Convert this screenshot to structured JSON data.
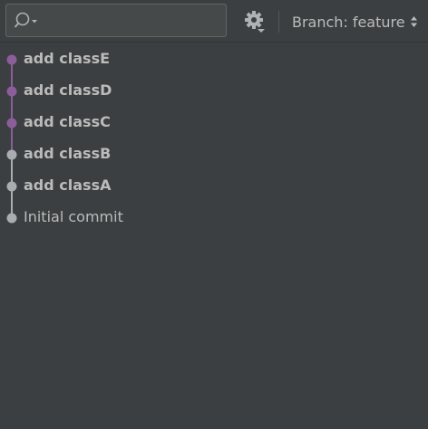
{
  "toolbar": {
    "search": {
      "placeholder": "",
      "value": ""
    },
    "settings_icon": "gear-icon",
    "branch": {
      "prefix": "Branch:",
      "name": "feature",
      "arrows_icon": "up-down-arrows-icon"
    }
  },
  "colors": {
    "background": "#3c3f41",
    "branch_feature": "#8c5d9b",
    "branch_main": "#a9adb0",
    "text": "#bbbbbb"
  },
  "commits": [
    {
      "message": "add classE",
      "bold": true,
      "branch": "feature"
    },
    {
      "message": "add classD",
      "bold": true,
      "branch": "feature"
    },
    {
      "message": "add classC",
      "bold": true,
      "branch": "feature"
    },
    {
      "message": "add classB",
      "bold": true,
      "branch": "main"
    },
    {
      "message": "add classA",
      "bold": true,
      "branch": "main"
    },
    {
      "message": "Initial commit",
      "bold": false,
      "branch": "main"
    }
  ]
}
